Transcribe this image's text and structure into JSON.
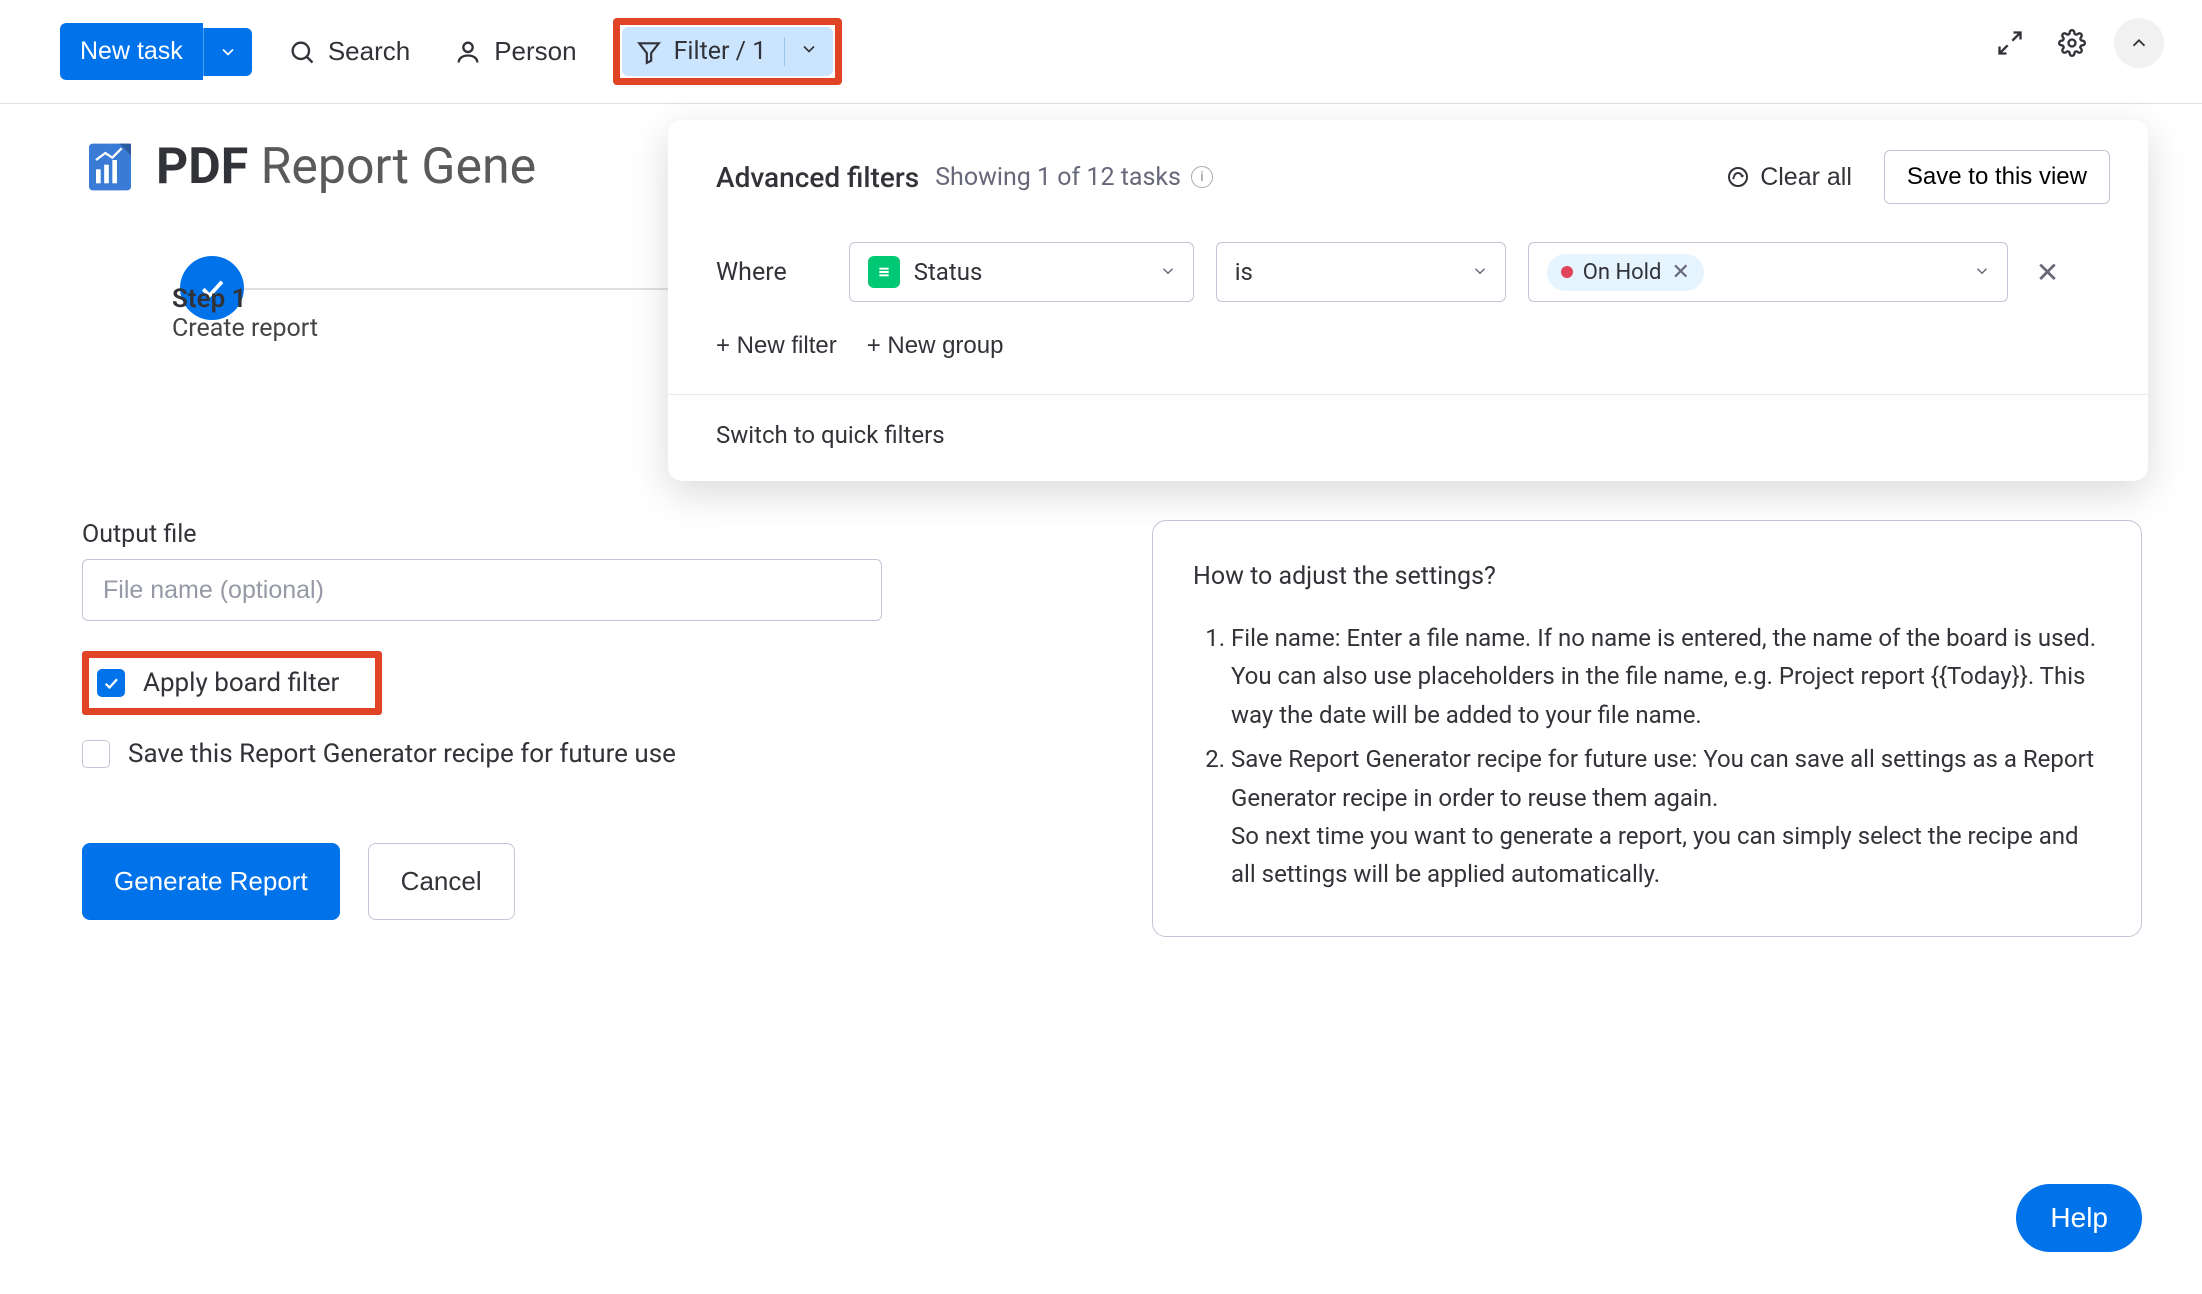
{
  "toolbar": {
    "new_task": "New task",
    "search": "Search",
    "person": "Person",
    "filter_label": "Filter / 1"
  },
  "title": {
    "bold": "PDF",
    "rest": " Report Gene"
  },
  "steps": {
    "step1_num": "Step 1",
    "step1_sub": "Create report"
  },
  "form": {
    "output_label": "Output file",
    "output_placeholder": "File name (optional)",
    "apply_filter": "Apply board filter",
    "save_recipe": "Save this Report Generator recipe for future use",
    "generate": "Generate Report",
    "cancel": "Cancel"
  },
  "help_panel": {
    "heading": "How to adjust the settings?",
    "item1a": "File name: Enter a file name. If no name is entered, the name of the board is used.",
    "item1b": "You can also use placeholders in the file name, e.g. Project report {{Today}}. This way the date will be added to your file name.",
    "item2a": "Save Report Generator recipe for future use: You can save all settings as a Report Generator recipe in order to reuse them again.",
    "item2b": "So next time you want to generate a report, you can simply select the recipe and all settings will be applied automatically."
  },
  "popover": {
    "title": "Advanced filters",
    "showing": "Showing 1 of 12 tasks",
    "clear_all": "Clear all",
    "save_view": "Save to this view",
    "where": "Where",
    "col": "Status",
    "op": "is",
    "val": "On Hold",
    "new_filter": "+ New filter",
    "new_group": "+ New group",
    "switch": "Switch to quick filters"
  },
  "help_btn": "Help"
}
